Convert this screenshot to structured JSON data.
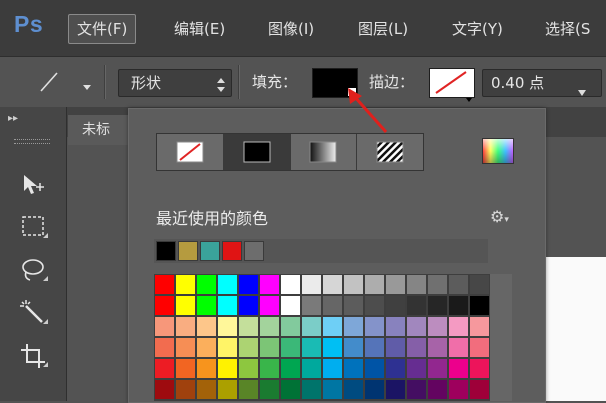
{
  "app": {
    "logo": "Ps"
  },
  "menubar": {
    "items": [
      {
        "label": "文件(F)",
        "active": true
      },
      {
        "label": "编辑(E)"
      },
      {
        "label": "图像(I)"
      },
      {
        "label": "图层(L)"
      },
      {
        "label": "文字(Y)"
      },
      {
        "label": "选择(S"
      }
    ]
  },
  "options": {
    "tool_icon": "line-tool-icon",
    "mode_value": "形状",
    "fill_label": "填充：",
    "fill_color": "#000000",
    "stroke_label": "描边：",
    "stroke_color": "none",
    "stroke_width": "0.40 点"
  },
  "document": {
    "tab_label": "未标"
  },
  "popup": {
    "fill_types": [
      {
        "name": "no-color",
        "icon": "no-color-icon"
      },
      {
        "name": "solid-color",
        "icon": "solid-color-icon",
        "selected": true
      },
      {
        "name": "gradient",
        "icon": "gradient-icon"
      },
      {
        "name": "pattern",
        "icon": "pattern-icon"
      }
    ],
    "recent_label": "最近使用的颜色",
    "recent_colors": [
      "#000000",
      "#b59b3f",
      "#3aa39a",
      "#e01414",
      "#6d6d6d"
    ],
    "swatch_rows": [
      [
        "#ff0000",
        "#ffff00",
        "#00ff00",
        "#00ffff",
        "#0000ff",
        "#ff00ff",
        "#ffffff",
        "#ebebeb",
        "#d6d6d6",
        "#c2c2c2",
        "#adadad",
        "#999999",
        "#858585",
        "#707070",
        "#5c5c5c",
        "#474747"
      ],
      [
        "#ff0000",
        "#ffff00",
        "#00ff00",
        "#00ffff",
        "#0000ff",
        "#ff00ff",
        "#ffffff",
        "#7a7a7a",
        "#666666",
        "#5c5c5c",
        "#4d4d4d",
        "#404040",
        "#333333",
        "#262626",
        "#1a1a1a",
        "#000000"
      ],
      [
        "#f7977a",
        "#f9ad81",
        "#fdc68a",
        "#fff79a",
        "#c4df9b",
        "#a3d39c",
        "#82ca9d",
        "#7bcdc8",
        "#6ecff6",
        "#7ea7d8",
        "#8493ca",
        "#8882be",
        "#a187be",
        "#bc8dbf",
        "#f49ac2",
        "#f6989d"
      ],
      [
        "#f26c4f",
        "#f68e55",
        "#fbaf5c",
        "#fff467",
        "#acd372",
        "#7cc576",
        "#3bb878",
        "#1abbb4",
        "#00bff3",
        "#438ccb",
        "#5574b9",
        "#605ca8",
        "#855fa8",
        "#a763a8",
        "#f06ea9",
        "#f26d7d"
      ],
      [
        "#ed1c24",
        "#f26522",
        "#f7941d",
        "#fff200",
        "#8dc73f",
        "#39b54a",
        "#00a651",
        "#00a99d",
        "#00aeef",
        "#0072bc",
        "#0054a6",
        "#2e3192",
        "#662d91",
        "#92278f",
        "#ec008c",
        "#ed145b"
      ],
      [
        "#9e0b0f",
        "#a0410d",
        "#a36209",
        "#aba000",
        "#598527",
        "#1a7b30",
        "#007236",
        "#00746b",
        "#0076a3",
        "#004b80",
        "#003471",
        "#1b1464",
        "#440e62",
        "#630460",
        "#9e005d",
        "#9e0039"
      ]
    ]
  },
  "colors": {
    "accent_arrow": "#e0201c",
    "menubar_bg": "#3c3c3c",
    "panel_bg": "#5d5d5d"
  }
}
